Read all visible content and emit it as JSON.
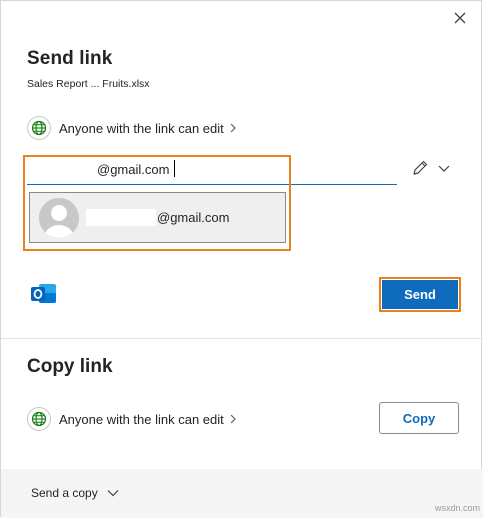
{
  "dialog": {
    "title": "Send link",
    "filename": "Sales Report ... Fruits.xlsx"
  },
  "send_section": {
    "permission_label": "Anyone with the link can edit",
    "to_value": "@gmail.com",
    "suggestion_email": "@gmail.com",
    "send_label": "Send"
  },
  "copy_section": {
    "title": "Copy link",
    "permission_label": "Anyone with the link can edit",
    "copy_label": "Copy"
  },
  "footer": {
    "send_copy_label": "Send a copy"
  },
  "watermark": "wsxdn.com",
  "colors": {
    "accent": "#0f6cbd",
    "highlight": "#e8821e",
    "globe": "#107c10",
    "outlook": "#0078d4"
  },
  "icons": [
    "close-icon",
    "globe-icon",
    "chevron-right-icon",
    "pencil-icon",
    "chevron-down-icon",
    "outlook-icon",
    "avatar"
  ]
}
